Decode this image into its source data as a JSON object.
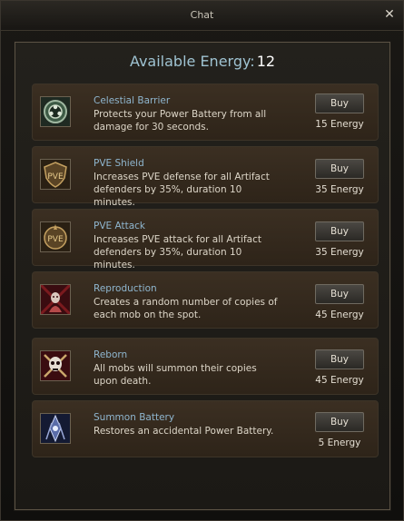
{
  "window": {
    "title": "Chat",
    "close_label": "✕"
  },
  "energy": {
    "label": "Available Energy:",
    "value": "12"
  },
  "items": [
    {
      "name": "Celestial Barrier",
      "description": "Protects your Power Battery from all damage for 30 seconds.",
      "buy_label": "Buy",
      "cost": "15 Energy",
      "icon": "celestial-barrier-icon"
    },
    {
      "name": "PVE Shield",
      "description": "Increases PVE defense for all Artifact defenders by 35%, duration 10 minutes.",
      "buy_label": "Buy",
      "cost": "35 Energy",
      "icon": "pve-shield-icon"
    },
    {
      "name": "PVE Attack",
      "description": "Increases PVE attack for all Artifact defenders by 35%, duration 10 minutes.",
      "buy_label": "Buy",
      "cost": "35 Energy",
      "icon": "pve-attack-icon"
    },
    {
      "name": "Reproduction",
      "description": "Creates a random number of copies of each mob on the spot.",
      "buy_label": "Buy",
      "cost": "45 Energy",
      "icon": "reproduction-icon"
    },
    {
      "name": "Reborn",
      "description": "All mobs will summon their copies upon death.",
      "buy_label": "Buy",
      "cost": "45 Energy",
      "icon": "reborn-icon"
    },
    {
      "name": "Summon Battery",
      "description": "Restores an accidental Power Battery.",
      "buy_label": "Buy",
      "cost": "5 Energy",
      "icon": "summon-battery-icon"
    }
  ]
}
